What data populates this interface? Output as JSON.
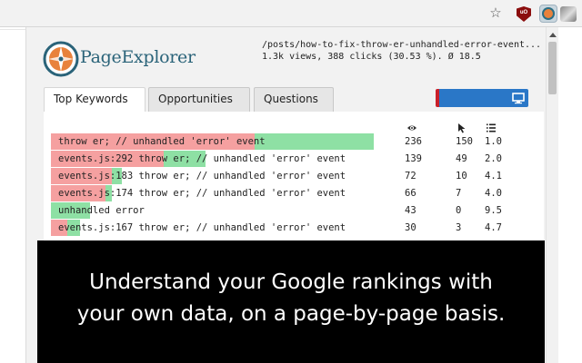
{
  "popup": {
    "brand": "PageExplorer",
    "url": "/posts/how-to-fix-throw-er-unhandled-error-event...",
    "stats": "1.3k views, 388 clicks (30.53 %). Ø 18.5"
  },
  "tabs": [
    {
      "label": "Top Keywords",
      "active": true
    },
    {
      "label": "Opportunities",
      "active": false
    },
    {
      "label": "Questions",
      "active": false
    }
  ],
  "columns": [
    {
      "icon": "eye-icon",
      "meaning": "views"
    },
    {
      "icon": "cursor-icon",
      "meaning": "clicks"
    },
    {
      "icon": "list-icon",
      "meaning": "position"
    }
  ],
  "keywords": [
    {
      "keyword": "throw er; // unhandled 'error' event",
      "views": "236",
      "clicks": "150",
      "position": "1.0",
      "bars": {
        "red": 0.63,
        "green": 0.37
      }
    },
    {
      "keyword": "events.js:292 throw er; // unhandled 'error' event",
      "views": "139",
      "clicks": "49",
      "position": "2.0",
      "bars": {
        "red": 0.35,
        "green": 0.13
      }
    },
    {
      "keyword": "events.js:183 throw er; // unhandled 'error' event",
      "views": "72",
      "clicks": "10",
      "position": "4.1",
      "bars": {
        "red": 0.19,
        "green": 0.03
      }
    },
    {
      "keyword": "events.js:174 throw er; // unhandled 'error' event",
      "views": "66",
      "clicks": "7",
      "position": "4.0",
      "bars": {
        "red": 0.17,
        "green": 0.02
      }
    },
    {
      "keyword": "unhandled error",
      "views": "43",
      "clicks": "0",
      "position": "9.5",
      "bars": {
        "red": 0.0,
        "green": 0.12
      }
    },
    {
      "keyword": "events.js:167 throw er; // unhandled 'error' event",
      "views": "30",
      "clicks": "3",
      "position": "4.7",
      "bars": {
        "red": 0.05,
        "green": 0.04
      }
    }
  ],
  "caption": {
    "line1": "Understand your Google rankings with",
    "line2": "your own data, on a page-by-page basis."
  },
  "colors": {
    "brand": "#2a6379",
    "logo_orange": "#e8823c",
    "bar_red": "#f5a0a0",
    "bar_green": "#8ee0a4",
    "device_button": "#2a77c7",
    "device_accent": "#c9202a"
  },
  "toolbar": {
    "icons": [
      "star-icon",
      "ublock-icon",
      "pageexplorer-extension-icon",
      "profile-avatar-icon"
    ],
    "ublock_badge": "uO"
  }
}
